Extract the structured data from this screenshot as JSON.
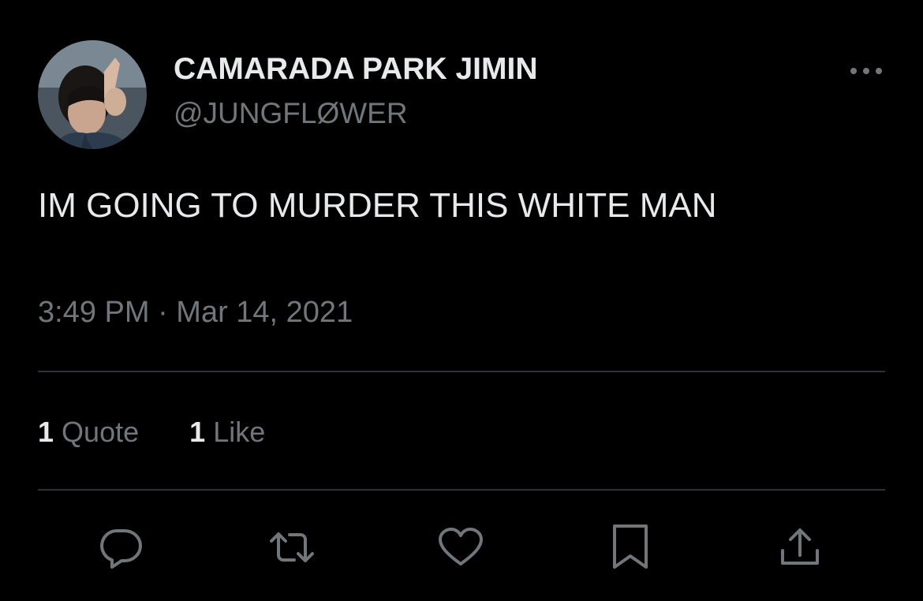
{
  "author": {
    "display_name": "CAMARADA PARK JIMIN",
    "handle": "@JUNGFLØWER",
    "avatar": "avatar-photo"
  },
  "tweet": {
    "text": "IM GOING TO MURDER THIS WHITE MAN",
    "timestamp": "3:49 PM · Mar 14, 2021"
  },
  "stats": {
    "quotes": {
      "count": "1",
      "label": "Quote"
    },
    "likes": {
      "count": "1",
      "label": "Like"
    }
  },
  "actions": [
    "reply-icon",
    "retweet-icon",
    "like-icon",
    "bookmark-icon",
    "share-icon"
  ],
  "menu_icon": "more-icon",
  "colors": {
    "background": "#000000",
    "primary_text": "#e7e9ea",
    "secondary_text": "#71767b",
    "divider": "#2f3336"
  }
}
